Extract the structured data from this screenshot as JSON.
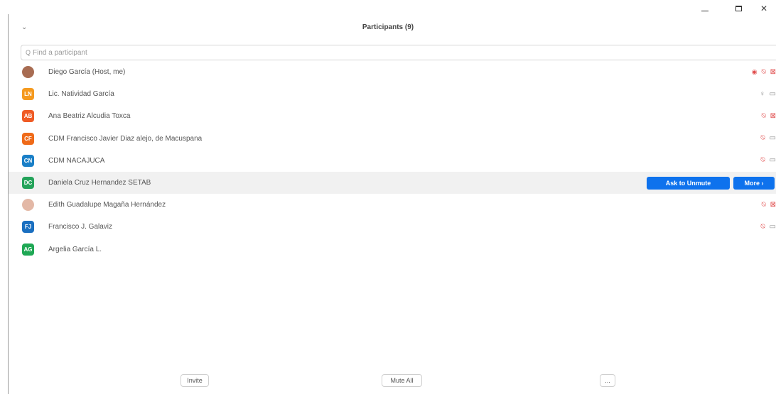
{
  "window": {
    "minimize_label": "—",
    "close_label": "✕"
  },
  "header": {
    "collapse_glyph": "⌄",
    "title": "Participants (9)"
  },
  "search": {
    "placeholder": "Find a participant",
    "value": ""
  },
  "colors": {
    "accent": "#0e72ed",
    "muted": "#e04b4b"
  },
  "participants": [
    {
      "name": "Diego García (Host, me)",
      "initials": "",
      "avatar_color": "#a86c52",
      "avatar_type": "photo",
      "share": true,
      "mic": "muted",
      "video": "off"
    },
    {
      "name": "Lic. Natividad García",
      "initials": "LN",
      "avatar_color": "#f59a1f",
      "avatar_type": "initials",
      "share": false,
      "mic": "on",
      "video": "on"
    },
    {
      "name": "Ana Beatriz Alcudia Toxca",
      "initials": "AB",
      "avatar_color": "#ef5b25",
      "avatar_type": "initials",
      "share": false,
      "mic": "muted",
      "video": "off"
    },
    {
      "name": "CDM Francisco Javier Diaz alejo, de Macuspana",
      "initials": "CF",
      "avatar_color": "#ef6a19",
      "avatar_type": "initials",
      "share": false,
      "mic": "muted",
      "video": "on"
    },
    {
      "name": "CDM NACAJUCA",
      "initials": "CN",
      "avatar_color": "#1a7fc7",
      "avatar_type": "initials",
      "share": false,
      "mic": "muted",
      "video": "on"
    },
    {
      "name": "Daniela Cruz Hernandez SETAB",
      "initials": "DC",
      "avatar_color": "#24a35a",
      "avatar_type": "initials",
      "share": false,
      "mic": "",
      "video": ""
    },
    {
      "name": "Edith Guadalupe Magaña Hernández",
      "initials": "",
      "avatar_color": "#e3b8a6",
      "avatar_type": "photo",
      "share": false,
      "mic": "muted",
      "video": "off"
    },
    {
      "name": "Francisco J. Galaviz",
      "initials": "FJ",
      "avatar_color": "#1a6fc0",
      "avatar_type": "initials",
      "share": false,
      "mic": "muted",
      "video": "on"
    },
    {
      "name": "Argelia García L.",
      "initials": "AG",
      "avatar_color": "#1fa855",
      "avatar_type": "initials",
      "share": false,
      "mic": "",
      "video": ""
    }
  ],
  "row_actions": {
    "ask_to_unmute": "Ask to Unmute",
    "more": "More ›"
  },
  "footer": {
    "invite": "Invite",
    "mute_all": "Mute All",
    "more": "..."
  }
}
